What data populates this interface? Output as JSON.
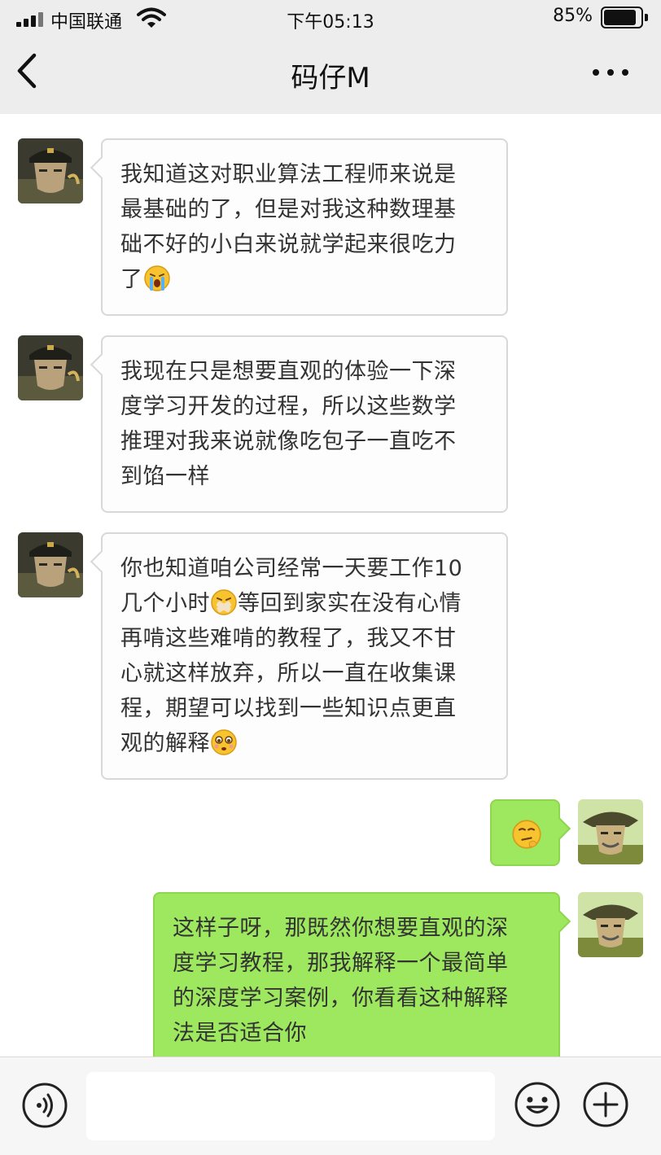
{
  "status_bar": {
    "carrier": "中国联通",
    "time": "下午05:13",
    "battery_percent": "85%",
    "battery_level": 0.85,
    "icons": [
      "signal-icon",
      "wifi-icon",
      "battery-icon"
    ]
  },
  "nav": {
    "title": "码仔M",
    "back_icon": "chevron-left-icon",
    "more_icon": "more-dots-icon"
  },
  "messages": [
    {
      "sender": "other",
      "lines": [
        "我知道这对职业算法工程师来说是",
        "最基础的了，但是对我这种数理基",
        "础不好的小白来说就学起来很吃力",
        "了"
      ],
      "emoji": "crying-emoji"
    },
    {
      "sender": "other",
      "lines": [
        "我现在只是想要直观的体验一下深",
        "度学习开发的过程，所以这些数学",
        "推理对我来说就像吃包子一直吃不",
        "到馅一样"
      ]
    },
    {
      "sender": "other",
      "lines_before_emoji": [
        "你也知道咱公司经常一天要工作10",
        "几个小时"
      ],
      "mid_emoji": "bandaged-emoji",
      "line_after_emoji": "等回到家实在没有心情",
      "lines": [
        "再啃这些难啃的教程了，我又不甘",
        "心就这样放弃，所以一直在收集课",
        "程，期望可以找到一些知识点更直",
        "观的解释"
      ],
      "emoji": "pleading-emoji"
    },
    {
      "sender": "me",
      "emoji": "thinking-emoji"
    },
    {
      "sender": "me",
      "lines": [
        "这样子呀，那既然你想要直观的深",
        "度学习教程，那我解释一个最简单",
        "的深度学习案例，你看看这种解释",
        "法是否适合你"
      ]
    }
  ],
  "input_bar": {
    "placeholder": "",
    "voice_icon": "voice-icon",
    "emoji_icon": "smiley-icon",
    "plus_icon": "plus-circle-icon"
  },
  "colors": {
    "header_bg": "#ededed",
    "outgoing_bubble": "#9de85e",
    "incoming_bubble": "#fdfdfd"
  }
}
